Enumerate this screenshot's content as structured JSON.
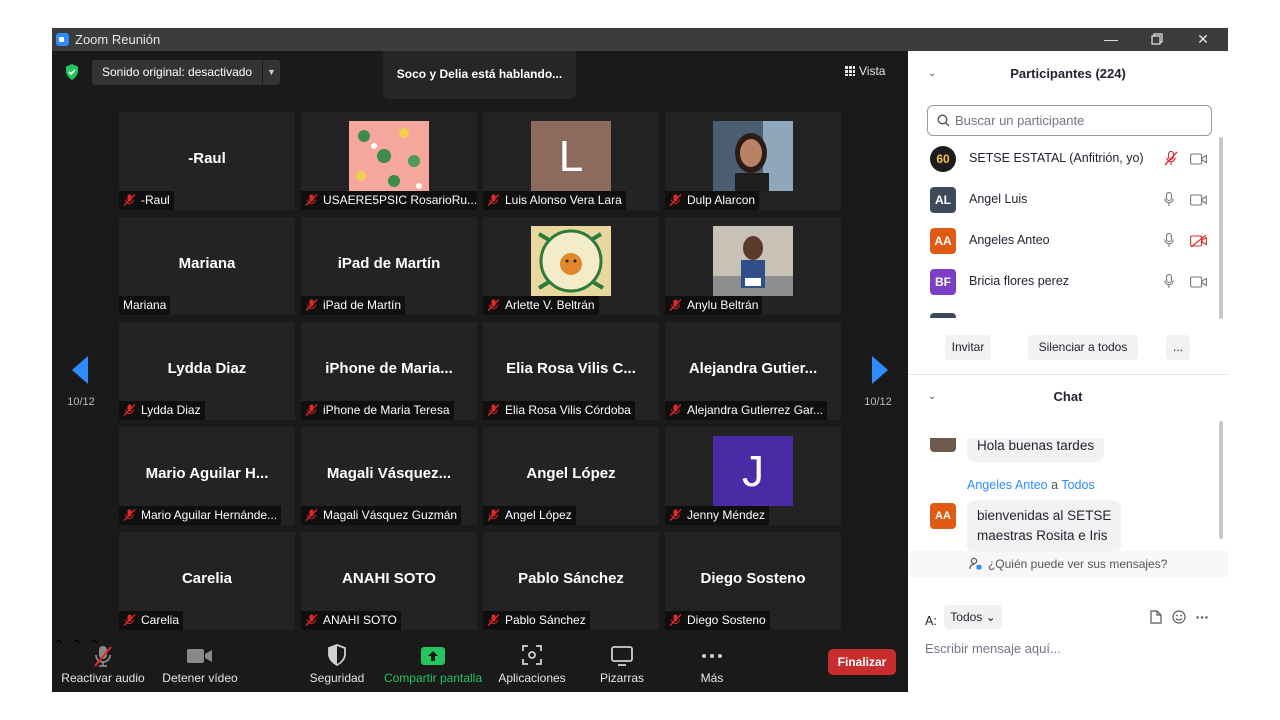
{
  "window": {
    "title": "Zoom Reunión"
  },
  "topbar": {
    "sound_label": "Sonido original: desactivado",
    "speaking": "Soco y Delia está hablando...",
    "view_label": "Vista"
  },
  "pager": {
    "left": "10/12",
    "right": "10/12"
  },
  "tiles": [
    {
      "big": "-Raul",
      "label": "-Raul",
      "muted": true
    },
    {
      "big": "",
      "label": "USAERE5PSIC RosarioRu...",
      "muted": true,
      "pic": "floral-pattern-photo"
    },
    {
      "big": "",
      "label": "Luis Alonso Vera Lara",
      "muted": true,
      "letter": "L",
      "letter_bg": "#8c6a5d"
    },
    {
      "big": "",
      "label": "Dulp Alarcon",
      "muted": true,
      "pic": "portrait-photo"
    },
    {
      "big": "Mariana",
      "label": "Mariana",
      "muted": false
    },
    {
      "big": "iPad de Martín",
      "label": "iPad de Martín",
      "muted": true
    },
    {
      "big": "",
      "label": "Arlette V. Beltrán",
      "muted": true,
      "pic": "supervision-escolar-logo"
    },
    {
      "big": "",
      "label": "Anylu Beltrán",
      "muted": true,
      "pic": "runner-photo"
    },
    {
      "big": "Lydda Diaz",
      "label": "Lydda Diaz",
      "muted": true
    },
    {
      "big": "iPhone  de  Maria...",
      "label": "iPhone de Maria Teresa",
      "muted": true
    },
    {
      "big": "Elia Rosa Vilis C...",
      "label": "Elia Rosa Vilis Córdoba",
      "muted": true
    },
    {
      "big": "Alejandra  Gutier...",
      "label": "Alejandra Gutierrez Gar...",
      "muted": true
    },
    {
      "big": "Mario  Aguilar  H...",
      "label": "Mario Aguilar Hernánde...",
      "muted": true
    },
    {
      "big": "Magali  Vásquez...",
      "label": "Magali Vásquez Guzmán",
      "muted": true
    },
    {
      "big": "Angel López",
      "label": "Angel López",
      "muted": true
    },
    {
      "big": "",
      "label": "Jenny Méndez",
      "muted": true,
      "letter": "J",
      "letter_bg": "#4b2aa6"
    },
    {
      "big": "Carelia",
      "label": "Carelia",
      "muted": true
    },
    {
      "big": "ANAHI SOTO",
      "label": "ANAHI SOTO",
      "muted": true
    },
    {
      "big": "Pablo Sánchez",
      "label": "Pablo Sánchez",
      "muted": true
    },
    {
      "big": "Diego Sosteno",
      "label": "Diego Sosteno",
      "muted": true
    }
  ],
  "toolbar": {
    "unmute": "Reactivar audio",
    "video": "Detener vídeo",
    "security": "Seguridad",
    "share": "Compartir pantalla",
    "apps": "Aplicaciones",
    "whiteboards": "Pizarras",
    "more": "Más",
    "end": "Finalizar"
  },
  "participants": {
    "header": "Participantes (224)",
    "search_placeholder": "Buscar un participante",
    "list": [
      {
        "initials": "60",
        "name": "SETSE ESTATAL (Anfitrión, yo)",
        "color": "#1c1c1c",
        "mic": "muted",
        "video": "on"
      },
      {
        "initials": "AL",
        "name": "Angel Luis",
        "color": "#3d4a5c",
        "mic": "on",
        "video": "on"
      },
      {
        "initials": "AA",
        "name": "Angeles Anteo",
        "color": "#e05a14",
        "mic": "on",
        "video": "off"
      },
      {
        "initials": "BF",
        "name": "Bricia flores perez",
        "color": "#7a3fc4",
        "mic": "on",
        "video": "on"
      }
    ],
    "buttons": {
      "invite": "Invitar",
      "mute_all": "Silenciar a todos",
      "more": "..."
    }
  },
  "chat": {
    "header": "Chat",
    "prev_message": "Hola buenas tardes",
    "sender": "Angeles Anteo",
    "to_word": "a",
    "recipient": "Todos",
    "sender_initials": "AA",
    "message_line1": "bienvenidas al SETSE",
    "message_line2": "maestras Rosita e Iris",
    "who_can_see": "¿Quién puede ver sus mensajes?",
    "to_label": "A:",
    "to_value": "Todos",
    "compose_placeholder": "Escribir mensaje aquí..."
  }
}
